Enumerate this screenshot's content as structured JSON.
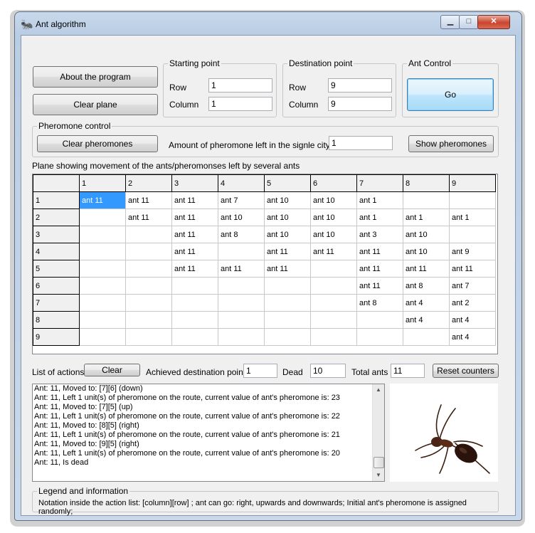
{
  "window": {
    "title": "Ant algorithm",
    "icon": "ant-icon"
  },
  "buttons": {
    "about": "About the program",
    "clear_plane": "Clear plane",
    "go": "Go",
    "clear_pheromones": "Clear pheromones",
    "show_pheromones": "Show pheromones",
    "clear_actions": "Clear",
    "reset_counters": "Reset counters"
  },
  "starting_point": {
    "label": "Starting point",
    "row_label": "Row",
    "row": "1",
    "column_label": "Column",
    "column": "1"
  },
  "destination_point": {
    "label": "Destination point",
    "row_label": "Row",
    "row": "9",
    "column_label": "Column",
    "column": "9"
  },
  "ant_control": {
    "label": "Ant Control"
  },
  "pheromone_control": {
    "label": "Pheromone control",
    "amount_label": "Amount of pheromone left in the signle city",
    "amount": "1"
  },
  "plane": {
    "caption": "Plane showing movement of the ants/pheromonses left by several ants",
    "columns": [
      "1",
      "2",
      "3",
      "4",
      "5",
      "6",
      "7",
      "8",
      "9"
    ],
    "rows": [
      {
        "h": "1",
        "c": [
          "ant 11",
          "ant 11",
          "ant 11",
          "ant 7",
          "ant 10",
          "ant 10",
          "ant 1",
          "",
          ""
        ]
      },
      {
        "h": "2",
        "c": [
          "",
          "ant 11",
          "ant 11",
          "ant 10",
          "ant 10",
          "ant 10",
          "ant 1",
          "ant 1",
          "ant 1"
        ]
      },
      {
        "h": "3",
        "c": [
          "",
          "",
          "ant 11",
          "ant 8",
          "ant 10",
          "ant 10",
          "ant 3",
          "ant 10",
          ""
        ]
      },
      {
        "h": "4",
        "c": [
          "",
          "",
          "ant 11",
          "",
          "ant 11",
          "ant 11",
          "ant 11",
          "ant 10",
          "ant 9"
        ]
      },
      {
        "h": "5",
        "c": [
          "",
          "",
          "ant 11",
          "ant 11",
          "ant 11",
          "",
          "ant 11",
          "ant 11",
          "ant 11"
        ]
      },
      {
        "h": "6",
        "c": [
          "",
          "",
          "",
          "",
          "",
          "",
          "ant 11",
          "ant 8",
          "ant 7"
        ]
      },
      {
        "h": "7",
        "c": [
          "",
          "",
          "",
          "",
          "",
          "",
          "ant 8",
          "ant 4",
          "ant 2"
        ]
      },
      {
        "h": "8",
        "c": [
          "",
          "",
          "",
          "",
          "",
          "",
          "",
          "ant 4",
          "ant 4"
        ]
      },
      {
        "h": "9",
        "c": [
          "",
          "",
          "",
          "",
          "",
          "",
          "",
          "",
          "ant 4"
        ]
      }
    ]
  },
  "actions": {
    "label": "List of actions",
    "achieved_label": "Achieved destination point",
    "achieved": "1",
    "dead_label": "Dead",
    "dead": "10",
    "total_label": "Total ants",
    "total": "11"
  },
  "log": [
    "Ant: 11, Moved to: [7][6] (down)",
    "Ant: 11, Left 1 unit(s) of pheromone on the route, current value of ant's pheromone is: 23",
    "Ant: 11, Moved to: [7][5] (up)",
    "Ant: 11, Left 1 unit(s) of pheromone on the route, current value of ant's pheromone is: 22",
    "Ant: 11, Moved to: [8][5] (right)",
    "Ant: 11, Left 1 unit(s) of pheromone on the route, current value of ant's pheromone is: 21",
    "Ant: 11, Moved to: [9][5] (right)",
    "Ant: 11, Left 1 unit(s) of pheromone on the route, current value of ant's pheromone is: 20",
    "Ant: 11, Is dead"
  ],
  "legend": {
    "label": "Legend and information",
    "text": "Notation inside the action list: [column][row] ; ant can go: right, upwards and downwards; Initial ant's pheromone is assigned randomly;"
  },
  "image": {
    "subject": "ant-photo"
  }
}
